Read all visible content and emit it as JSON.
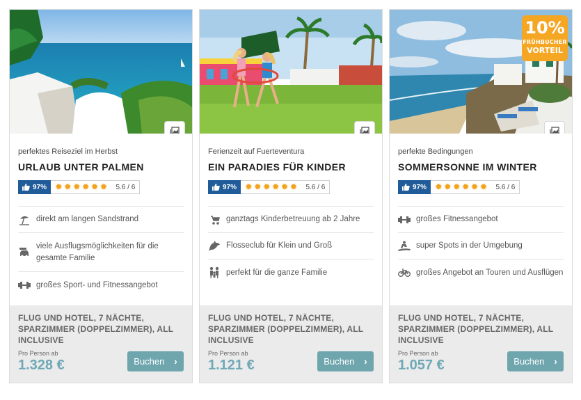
{
  "cards": [
    {
      "subtitle": "perfektes Reiseziel im Herbst",
      "title": "URLAUB UNTER PALMEN",
      "rating_percent": "97%",
      "stars": 6,
      "score": "5.6 / 6",
      "features": [
        {
          "icon": "beach-umbrella-icon",
          "text": "direkt am langen Sandstrand"
        },
        {
          "icon": "car-icon",
          "text": "viele Ausflugsmöglichkeiten für die gesamte Familie"
        },
        {
          "icon": "dumbbell-icon",
          "text": "großes Sport- und Fitnessangebot"
        }
      ],
      "offer": "FLUG UND HOTEL, 7 NÄCHTE, SPARZIMMER (DOPPELZIMMER), ALL INCLUSIVE",
      "per_person": "Pro Person ab",
      "price": "1.328 €",
      "button": "Buchen"
    },
    {
      "subtitle": "Ferienzeit auf Fuerteventura",
      "title": "EIN PARADIES FÜR KINDER",
      "rating_percent": "97%",
      "stars": 6,
      "score": "5.6 / 6",
      "features": [
        {
          "icon": "stroller-icon",
          "text": "ganztags Kinderbetreuung ab 2 Jahre"
        },
        {
          "icon": "dolphin-icon",
          "text": "Flosseclub für Klein und Groß"
        },
        {
          "icon": "family-icon",
          "text": "perfekt für die ganze Familie"
        }
      ],
      "offer": "FLUG UND HOTEL, 7 NÄCHTE, SPARZIMMER (DOPPELZIMMER), ALL INCLUSIVE",
      "per_person": "Pro Person ab",
      "price": "1.121 €",
      "button": "Buchen"
    },
    {
      "subtitle": "perfekte Bedingungen",
      "title": "SOMMERSONNE IM WINTER",
      "rating_percent": "97%",
      "stars": 6,
      "score": "5.6 / 6",
      "badge": {
        "percent": "10%",
        "line1": "FRÜHBUCHER",
        "line2": "VORTEIL"
      },
      "features": [
        {
          "icon": "dumbbell-icon",
          "text": "großes Fitnessangebot"
        },
        {
          "icon": "surfer-icon",
          "text": "super Spots in der Umgebung"
        },
        {
          "icon": "bicycle-icon",
          "text": "großes Angebot an Touren und Ausflügen"
        }
      ],
      "offer": "FLUG UND HOTEL, 7 NÄCHTE, SPARZIMMER (DOPPELZIMMER), ALL INCLUSIVE",
      "per_person": "Pro Person ab",
      "price": "1.057 €",
      "button": "Buchen"
    }
  ],
  "colors": {
    "rating_blue": "#1f5c99",
    "star_orange": "#f3a21a",
    "price_teal": "#6fa8b6",
    "button_teal": "#6fa6ae",
    "badge_orange": "#f5a623",
    "footer_gray": "#ebebeb"
  }
}
